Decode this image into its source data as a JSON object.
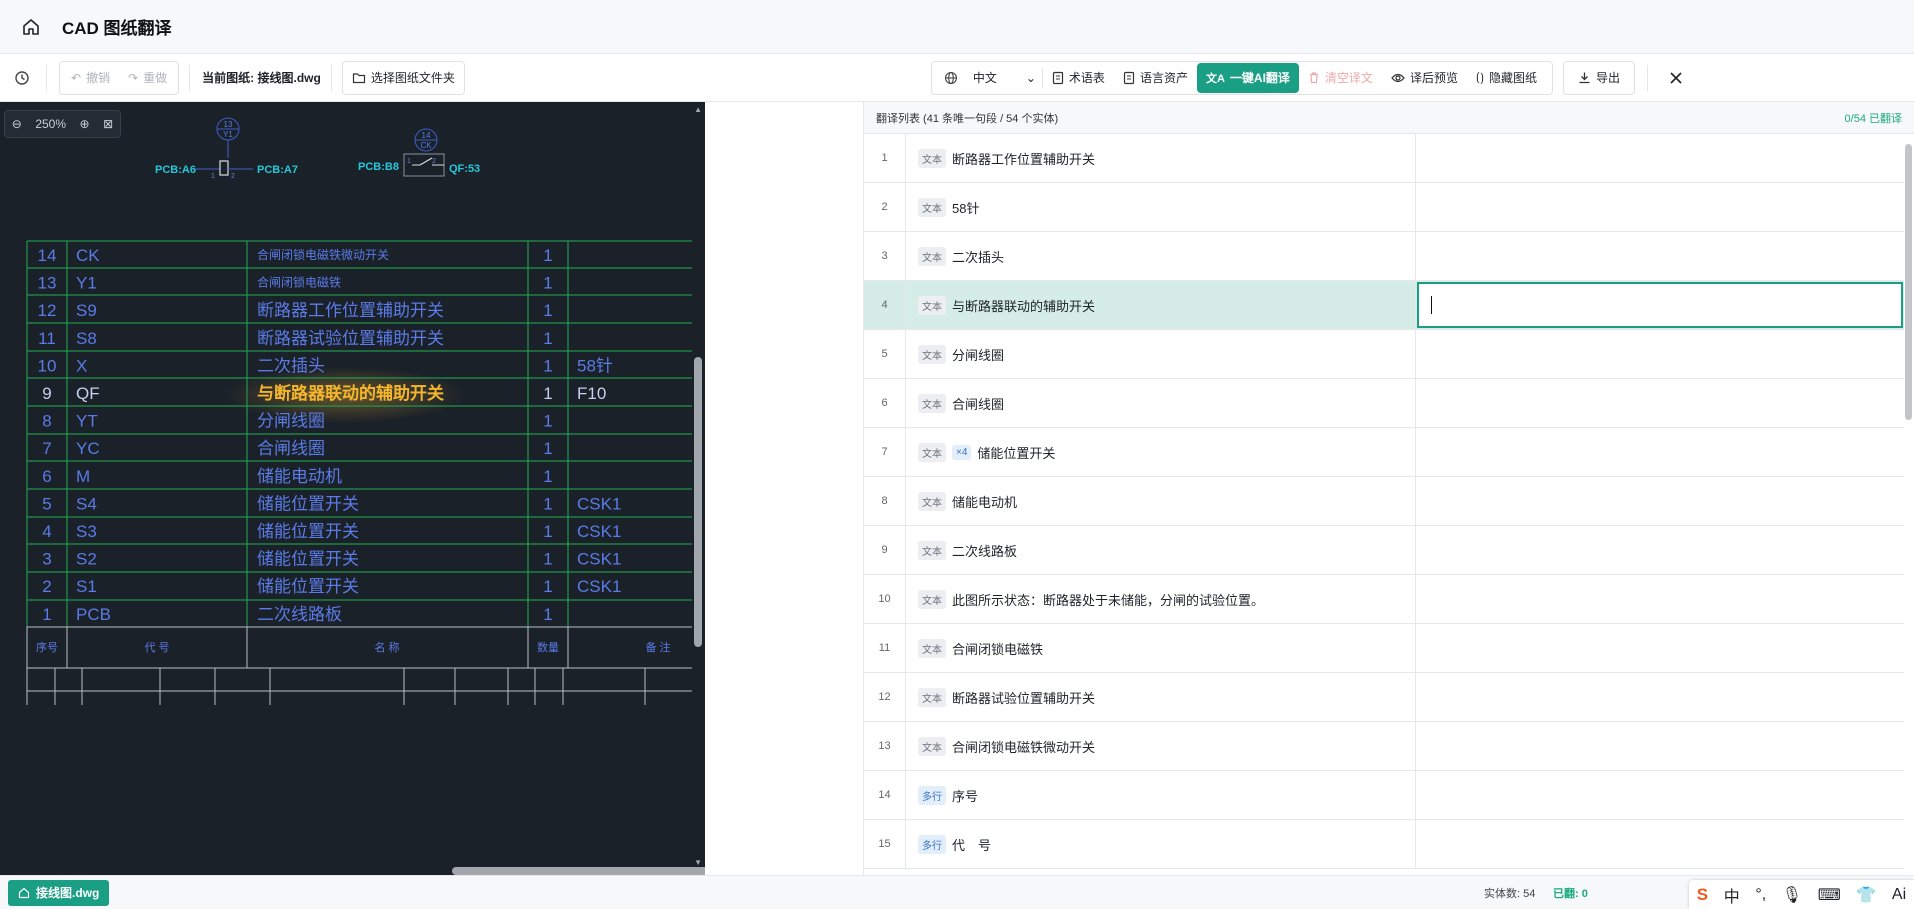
{
  "app": {
    "title": "CAD 图纸翻译"
  },
  "toolbar": {
    "undo": "撤销",
    "redo": "重做",
    "current_file_label": "当前图纸: 接线图.dwg",
    "choose_folder": "选择图纸文件夹",
    "language": "中文",
    "glossary": "术语表",
    "language_assets": "语言资产",
    "ai_translate": "一键AI翻译",
    "clear_translation": "清空译文",
    "preview": "译后预览",
    "hide_drawing": "隐藏图纸",
    "export": "导出"
  },
  "cad": {
    "zoom": "250%",
    "symbols": {
      "bubble1_top": "13",
      "bubble1_bottom": "Y1",
      "bubble2_top": "14",
      "bubble2_bottom": "CK",
      "left_a": "PCB:A6",
      "left_b": "PCB:A7",
      "coil_pin1": "1",
      "coil_pin2": "2",
      "right_a": "PCB:B8",
      "right_b": "QF:53",
      "sw_pin1": "1",
      "sw_pin2": "2"
    },
    "rows": [
      {
        "no": "14",
        "code": "CK",
        "name": "合闸闭锁电磁铁微动开关",
        "qty": "1",
        "note": ""
      },
      {
        "no": "13",
        "code": "Y1",
        "name": "合闸闭锁电磁铁",
        "qty": "1",
        "note": ""
      },
      {
        "no": "12",
        "code": "S9",
        "name": "断路器工作位置辅助开关",
        "qty": "1",
        "note": ""
      },
      {
        "no": "11",
        "code": "S8",
        "name": "断路器试验位置辅助开关",
        "qty": "1",
        "note": ""
      },
      {
        "no": "10",
        "code": "X",
        "name": "二次插头",
        "qty": "1",
        "note": "58针"
      },
      {
        "no": "9",
        "code": "QF",
        "name": "与断路器联动的辅助开关",
        "qty": "1",
        "note": "F10"
      },
      {
        "no": "8",
        "code": "YT",
        "name": "分闸线圈",
        "qty": "1",
        "note": ""
      },
      {
        "no": "7",
        "code": "YC",
        "name": "合闸线圈",
        "qty": "1",
        "note": ""
      },
      {
        "no": "6",
        "code": "M",
        "name": "储能电动机",
        "qty": "1",
        "note": ""
      },
      {
        "no": "5",
        "code": "S4",
        "name": "储能位置开关",
        "qty": "1",
        "note": "CSK1"
      },
      {
        "no": "4",
        "code": "S3",
        "name": "储能位置开关",
        "qty": "1",
        "note": "CSK1"
      },
      {
        "no": "3",
        "code": "S2",
        "name": "储能位置开关",
        "qty": "1",
        "note": "CSK1"
      },
      {
        "no": "2",
        "code": "S1",
        "name": "储能位置开关",
        "qty": "1",
        "note": "CSK1"
      },
      {
        "no": "1",
        "code": "PCB",
        "name": "二次线路板",
        "qty": "1",
        "note": ""
      }
    ],
    "header": {
      "no": "序号",
      "code": "代 号",
      "name": "名 称",
      "qty": "数量",
      "note": "备 注"
    }
  },
  "list": {
    "header": "翻译列表 (41 条唯一句段 / 54 个实体)",
    "progress": "0/54 已翻译",
    "items": [
      {
        "n": "1",
        "tag": "文本",
        "text": "断路器工作位置辅助开关"
      },
      {
        "n": "2",
        "tag": "文本",
        "text": "58针"
      },
      {
        "n": "3",
        "tag": "文本",
        "text": "二次插头"
      },
      {
        "n": "4",
        "tag": "文本",
        "text": "与断路器联动的辅助开关"
      },
      {
        "n": "5",
        "tag": "文本",
        "text": "分闸线圈"
      },
      {
        "n": "6",
        "tag": "文本",
        "text": "合闸线圈"
      },
      {
        "n": "7",
        "tag": "文本",
        "count": "×4",
        "text": "储能位置开关"
      },
      {
        "n": "8",
        "tag": "文本",
        "text": "储能电动机"
      },
      {
        "n": "9",
        "tag": "文本",
        "text": "二次线路板"
      },
      {
        "n": "10",
        "tag": "文本",
        "text": "此图所示状态：断路器处于未储能，分闸的试验位置。"
      },
      {
        "n": "11",
        "tag": "文本",
        "text": "合闸闭锁电磁铁"
      },
      {
        "n": "12",
        "tag": "文本",
        "text": "断路器试验位置辅助开关"
      },
      {
        "n": "13",
        "tag": "文本",
        "text": "合闸闭锁电磁铁微动开关"
      },
      {
        "n": "14",
        "tag": "多行",
        "text": "序号"
      },
      {
        "n": "15",
        "tag": "多行",
        "text": "代　号"
      }
    ]
  },
  "status": {
    "file_tab": "接线图.dwg",
    "entities": "实体数: 54",
    "translated": "已翻: 0"
  },
  "ime": {
    "lang": "中",
    "ai": "Ai"
  },
  "colors": {
    "accent": "#1a9e84",
    "cad_bg": "#1b2129",
    "cad_line": "#1fae4e",
    "cad_text": "#5a7be8",
    "highlight": "#f5b62d",
    "cyan": "#25c7d8"
  }
}
